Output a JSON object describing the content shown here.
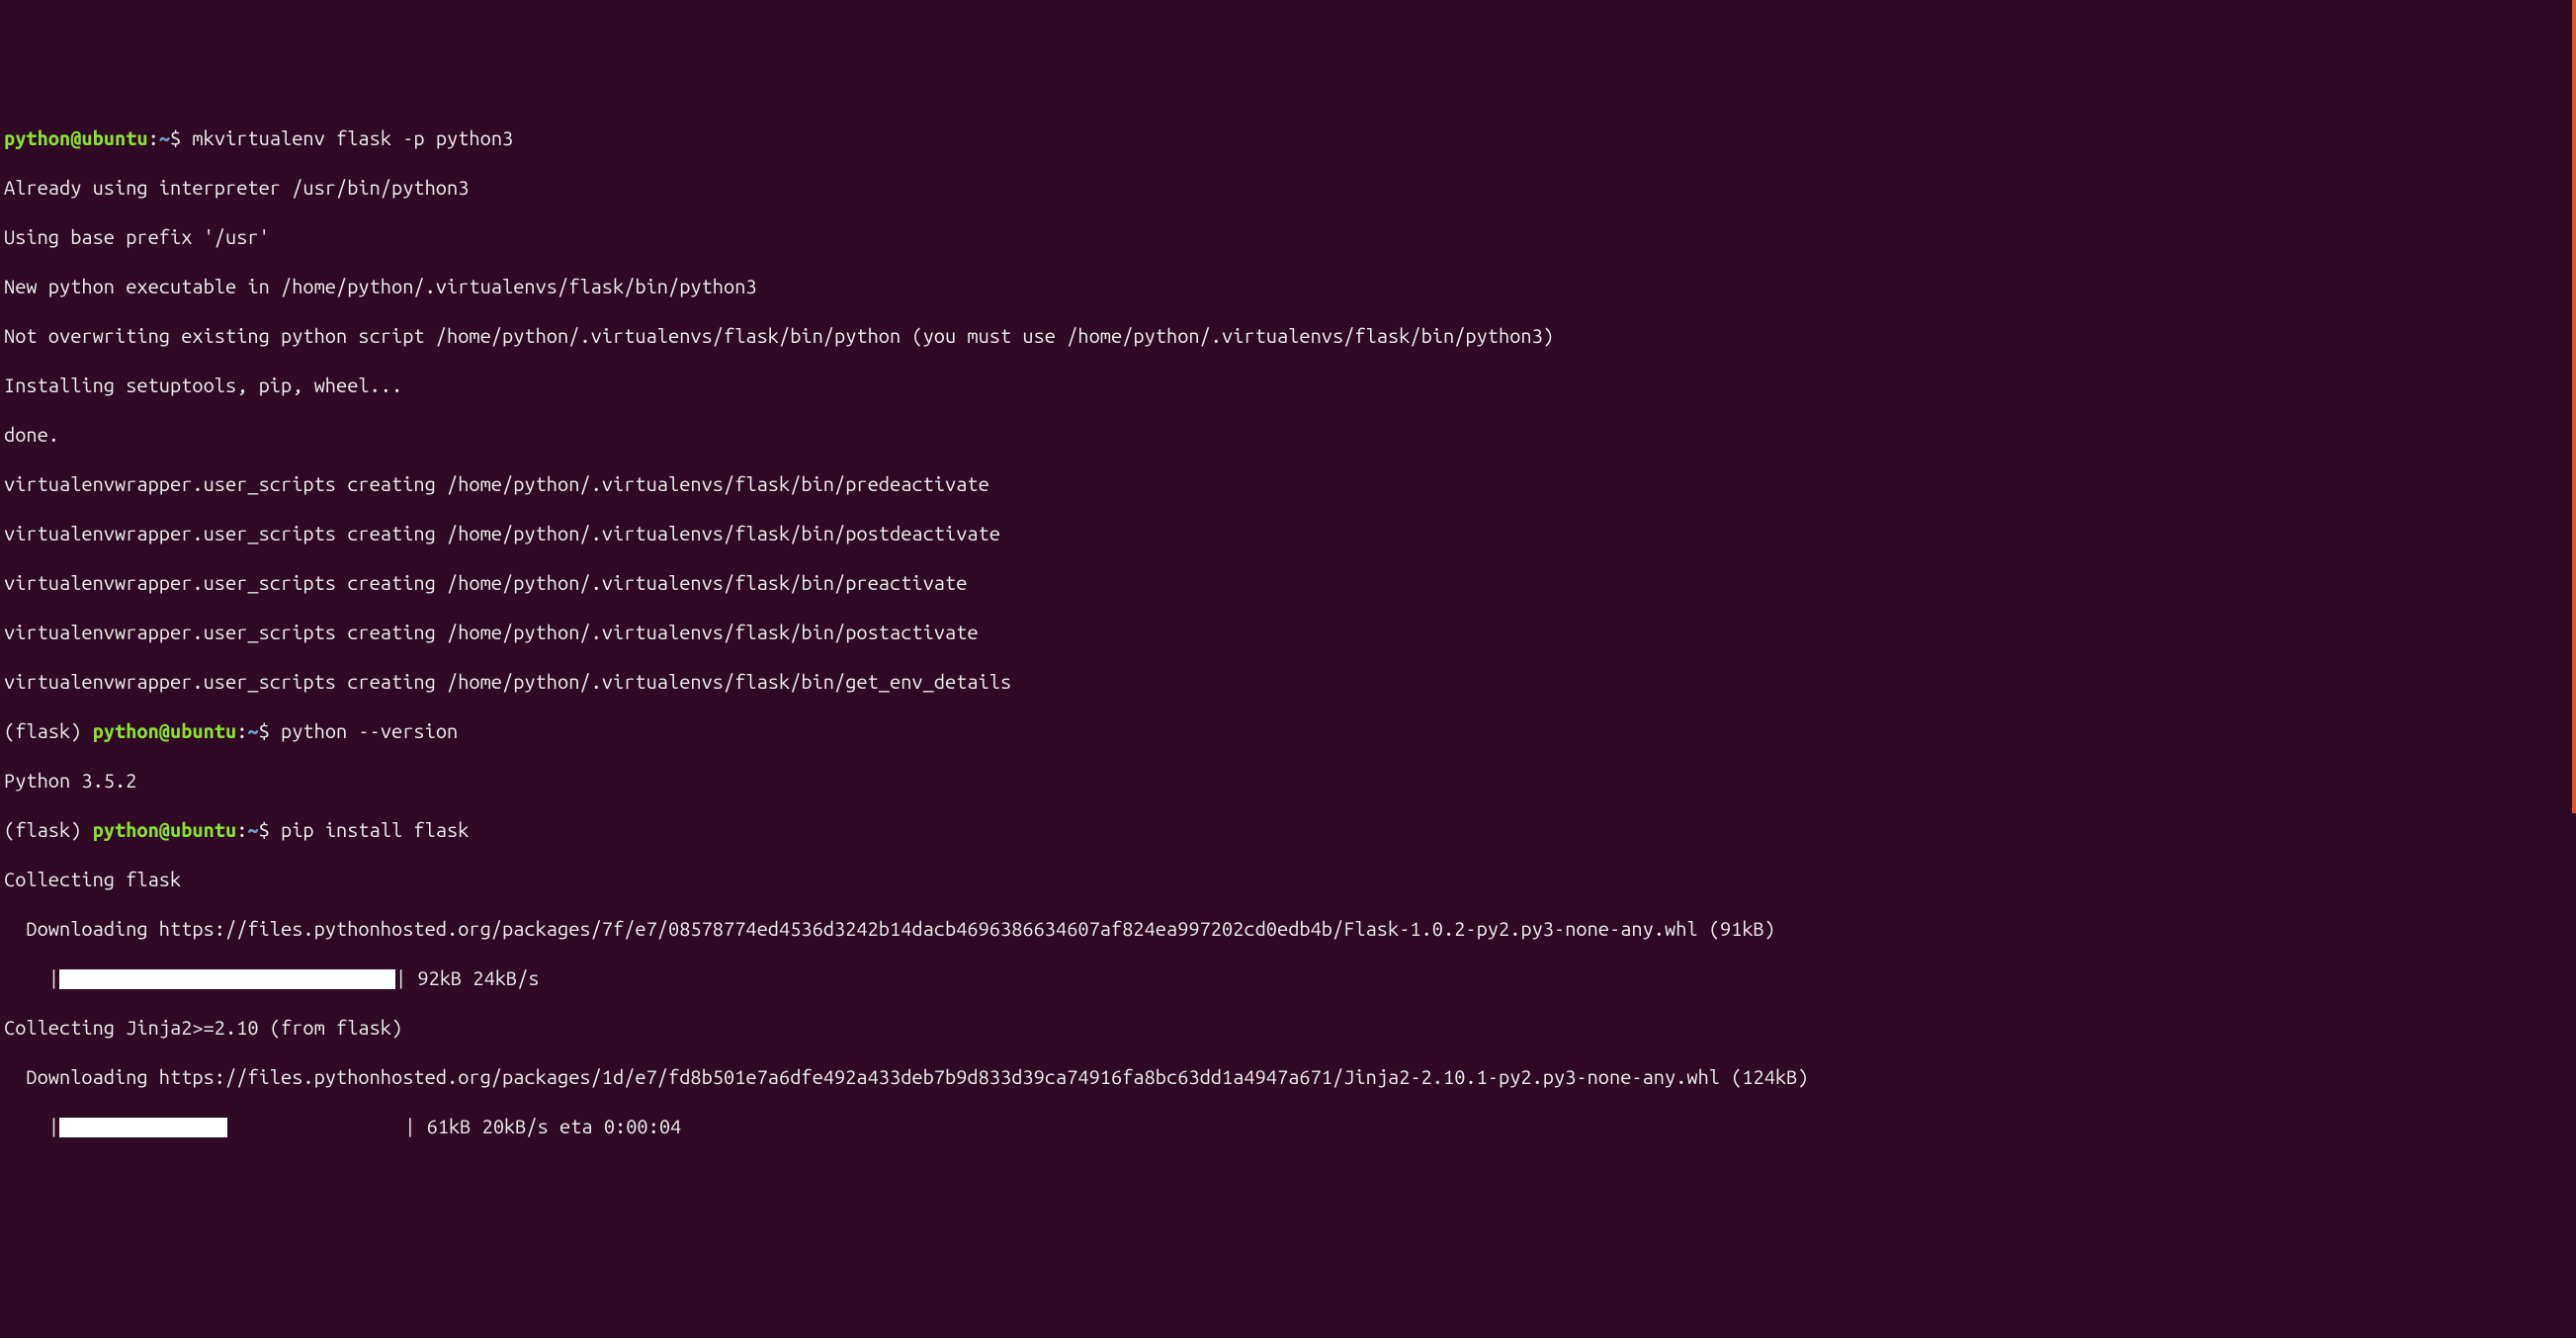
{
  "prompt1": {
    "user": "python@ubuntu",
    "sep": ":",
    "path": "~",
    "dollar": "$ ",
    "cmd": "mkvirtualenv flask -p python3"
  },
  "out1": [
    "Already using interpreter /usr/bin/python3",
    "Using base prefix '/usr'",
    "New python executable in /home/python/.virtualenvs/flask/bin/python3",
    "Not overwriting existing python script /home/python/.virtualenvs/flask/bin/python (you must use /home/python/.virtualenvs/flask/bin/python3)",
    "Installing setuptools, pip, wheel...",
    "done.",
    "virtualenvwrapper.user_scripts creating /home/python/.virtualenvs/flask/bin/predeactivate",
    "virtualenvwrapper.user_scripts creating /home/python/.virtualenvs/flask/bin/postdeactivate",
    "virtualenvwrapper.user_scripts creating /home/python/.virtualenvs/flask/bin/preactivate",
    "virtualenvwrapper.user_scripts creating /home/python/.virtualenvs/flask/bin/postactivate",
    "virtualenvwrapper.user_scripts creating /home/python/.virtualenvs/flask/bin/get_env_details"
  ],
  "prompt2": {
    "env": "(flask) ",
    "user": "python@ubuntu",
    "sep": ":",
    "path": "~",
    "dollar": "$ ",
    "cmd": "python --version"
  },
  "out2": "Python 3.5.2",
  "prompt3": {
    "env": "(flask) ",
    "user": "python@ubuntu",
    "sep": ":",
    "path": "~",
    "dollar": "$ ",
    "cmd": "pip install flask"
  },
  "out3": {
    "collect1": "Collecting flask",
    "dl1": "  Downloading https://files.pythonhosted.org/packages/7f/e7/08578774ed4536d3242b14dacb4696386634607af824ea997202cd0edb4b/Flask-1.0.2-py2.py3-none-any.whl (91kB)",
    "bar1_prefix": "    |",
    "bar1_suffix": "| 92kB 24kB/s ",
    "collect2": "Collecting Jinja2>=2.10 (from flask)",
    "dl2": "  Downloading https://files.pythonhosted.org/packages/1d/e7/fd8b501e7a6dfe492a433deb7b9d833d39ca74916fa8bc63dd1a4947a671/Jinja2-2.10.1-py2.py3-none-any.whl (124kB)",
    "bar2_prefix": "    |",
    "bar2_gap": "                ",
    "bar2_suffix": "| 61kB 20kB/s eta 0:00:04"
  }
}
